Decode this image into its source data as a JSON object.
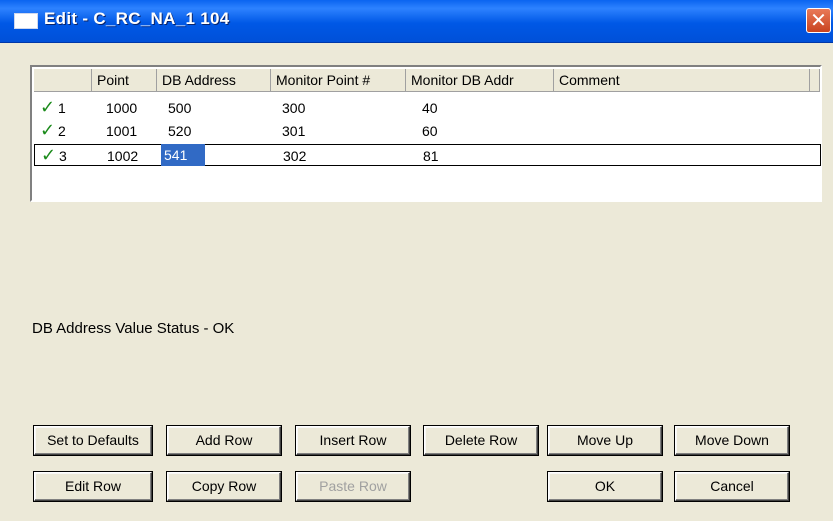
{
  "window": {
    "title": "Edit - C_RC_NA_1 104",
    "close_glyph": "✕"
  },
  "grid": {
    "columns": [
      "",
      "Point",
      "DB Address",
      "Monitor Point #",
      "Monitor DB Addr",
      "Comment"
    ],
    "rows": [
      {
        "num": "1",
        "point": "1000",
        "db_address": "500",
        "monitor_point": "300",
        "monitor_db_addr": "40",
        "comment": ""
      },
      {
        "num": "2",
        "point": "1001",
        "db_address": "520",
        "monitor_point": "301",
        "monitor_db_addr": "60",
        "comment": ""
      },
      {
        "num": "3",
        "point": "1002",
        "db_address": "541",
        "monitor_point": "302",
        "monitor_db_addr": "81",
        "comment": ""
      }
    ],
    "check_glyph": "✓",
    "selected_row": 3,
    "selected_column": "DB Address"
  },
  "status_text": "DB Address Value Status - OK",
  "buttons": {
    "set_defaults": "Set to Defaults",
    "add_row": "Add Row",
    "insert_row": "Insert Row",
    "delete_row": "Delete Row",
    "move_up": "Move Up",
    "move_down": "Move Down",
    "edit_row": "Edit Row",
    "copy_row": "Copy Row",
    "paste_row": "Paste Row",
    "ok": "OK",
    "cancel": "Cancel"
  },
  "colors": {
    "title_bar": "#0058e6",
    "selection": "#316ac5",
    "check": "#1a8a1a",
    "close": "#c9431f",
    "dialog_bg": "#ece9d8"
  }
}
